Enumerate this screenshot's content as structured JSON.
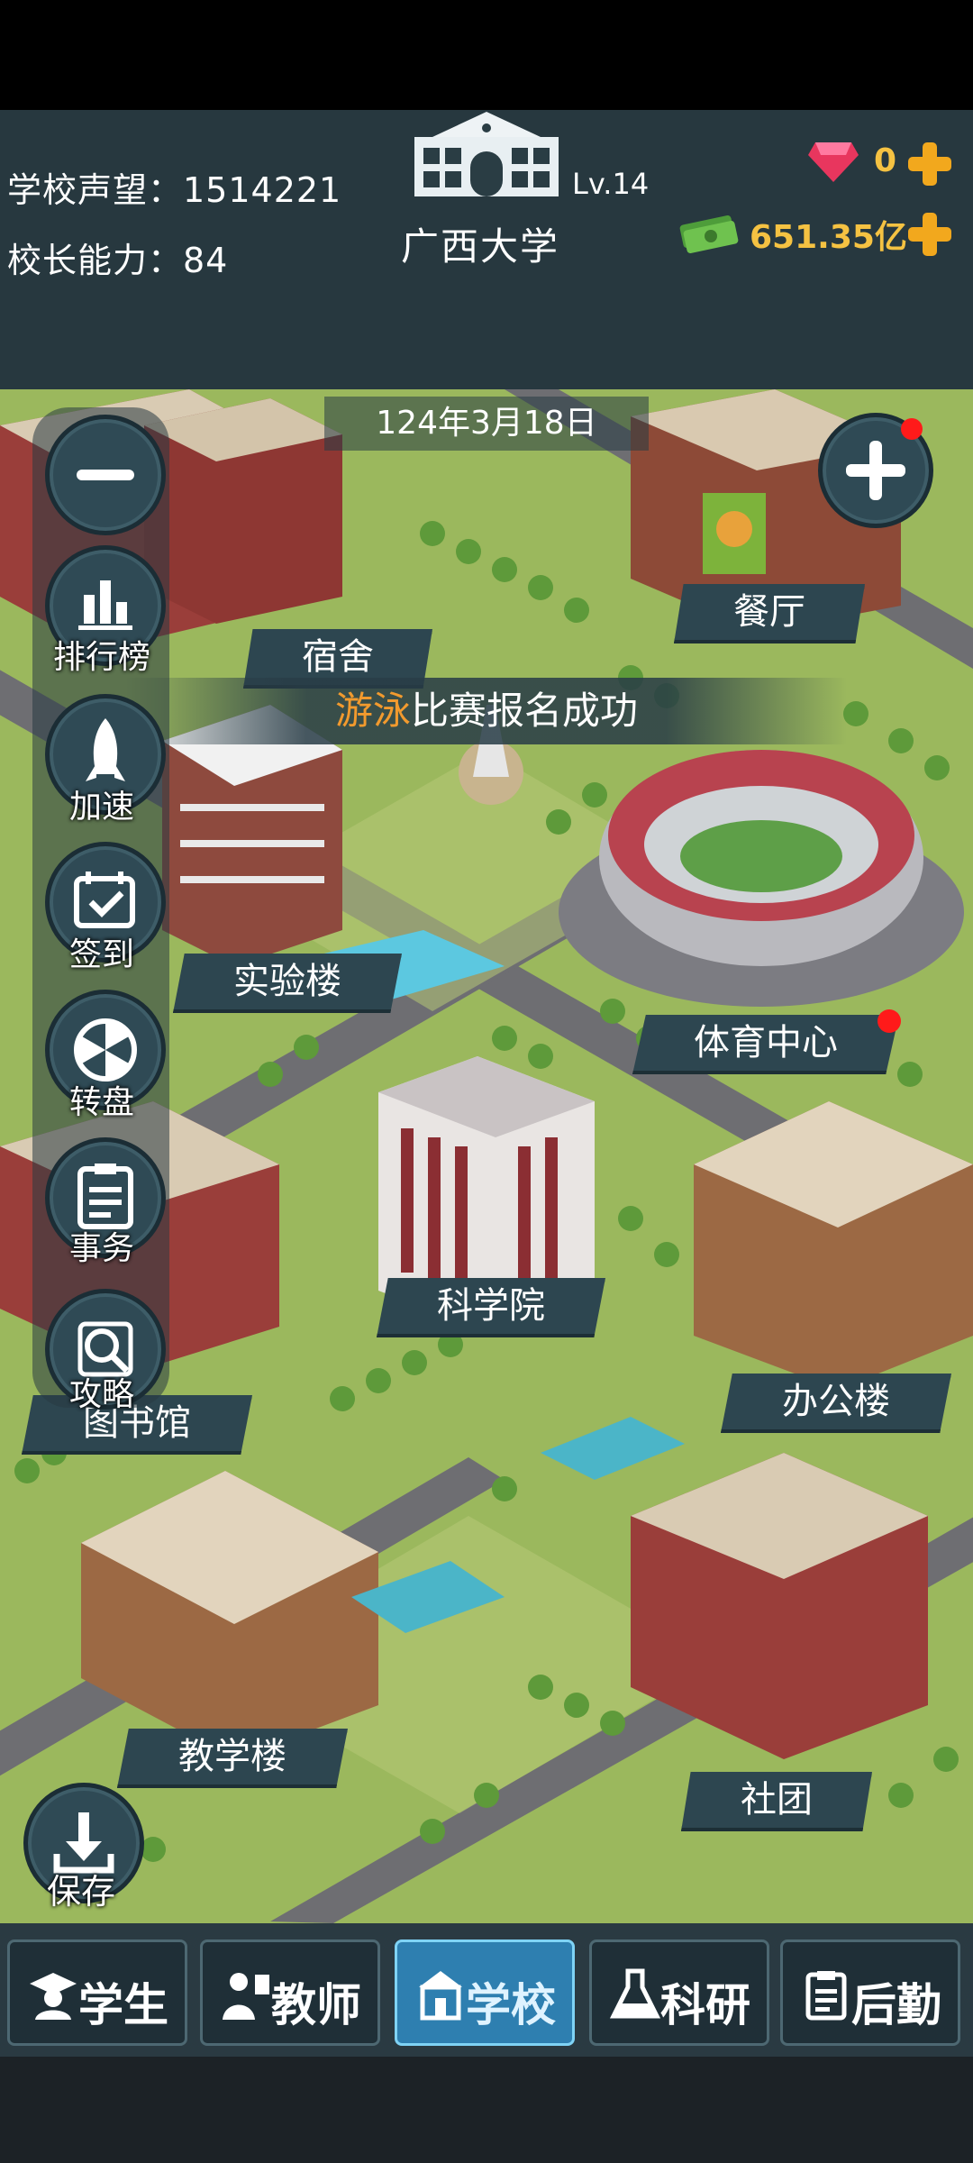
{
  "stats": {
    "reputation": "学校声望：1514221",
    "ability": "校长能力：84"
  },
  "school": {
    "name": "广西大学",
    "level": "Lv.14"
  },
  "currency": {
    "gems": "0",
    "money": "651.35亿"
  },
  "date": "124年3月18日",
  "toast": {
    "highlight": "游泳",
    "rest": "比赛报名成功"
  },
  "sidebar": {
    "rank": "排行榜",
    "speed": "加速",
    "signin": "签到",
    "wheel": "转盘",
    "affairs": "事务",
    "guide": "攻略"
  },
  "save": "保存",
  "buildings": {
    "dorm": "宿舍",
    "restaurant": "餐厅",
    "lab": "实验楼",
    "sports": "体育中心",
    "science": "科学院",
    "office": "办公楼",
    "library": "图书馆",
    "teaching": "教学楼",
    "club": "社团"
  },
  "tabs": {
    "students": "学生",
    "teachers": "教师",
    "school": "学校",
    "research": "科研",
    "logistics": "后勤"
  },
  "colors": {
    "accent": "#f5c242",
    "hud": "#27383f",
    "active_tab": "#2e7fb0",
    "highlight": "#f29a2e"
  },
  "icons": [
    "gem-icon",
    "money-icon",
    "plus-icon",
    "minus-icon",
    "ranking-icon",
    "rocket-icon",
    "calendar-icon",
    "wheel-icon",
    "clipboard-icon",
    "magnifier-icon",
    "download-icon",
    "graduate-icon",
    "teacher-icon",
    "school-icon",
    "flask-icon",
    "checklist-icon"
  ]
}
